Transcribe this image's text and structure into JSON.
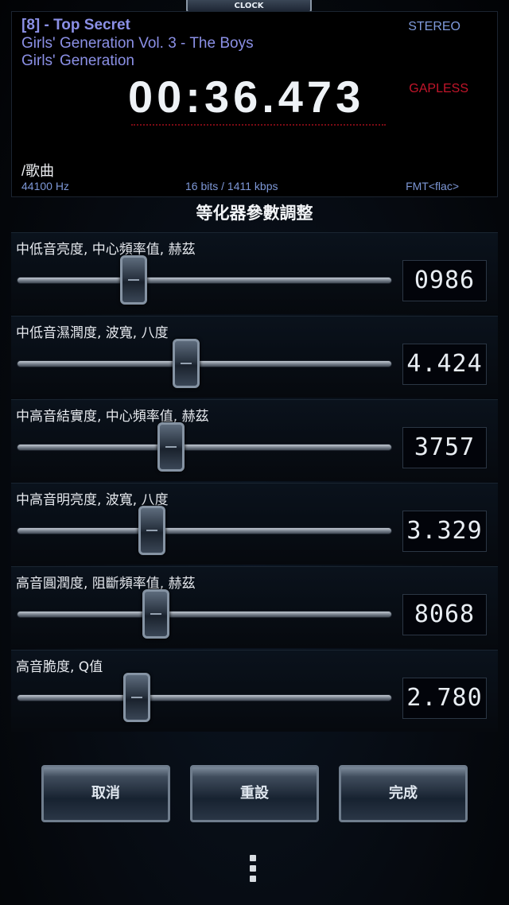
{
  "clock_tab": "CLOCK",
  "now_playing": {
    "title": "[8] - Top Secret",
    "album": "Girls' Generation Vol. 3 - The Boys",
    "artist": "Girls' Generation",
    "channel_mode": "STEREO",
    "gapless": "GAPLESS",
    "time": "00:36.473",
    "folder": "/歌曲",
    "sample_rate": "44100 Hz",
    "bitrate": "16 bits / 1411 kbps",
    "format": "FMT<flac>"
  },
  "eq_title": "等化器參數調整",
  "bands": [
    {
      "label": "中低音亮度, 中心頻率值, 赫茲",
      "value": "0986",
      "slider_fraction": 0.31
    },
    {
      "label": "中低音濕潤度, 波寬, 八度",
      "value": "4.424",
      "slider_fraction": 0.45
    },
    {
      "label": "中高音結實度, 中心頻率值, 赫茲",
      "value": "3757",
      "slider_fraction": 0.41
    },
    {
      "label": "中高音明亮度, 波寬, 八度",
      "value": "3.329",
      "slider_fraction": 0.36
    },
    {
      "label": "高音圓潤度, 阻斷頻率值, 赫茲",
      "value": "8068",
      "slider_fraction": 0.37
    },
    {
      "label": "高音脆度, Q值",
      "value": "2.780",
      "slider_fraction": 0.32
    }
  ],
  "buttons": {
    "cancel": "取消",
    "reset": "重設",
    "done": "完成"
  }
}
